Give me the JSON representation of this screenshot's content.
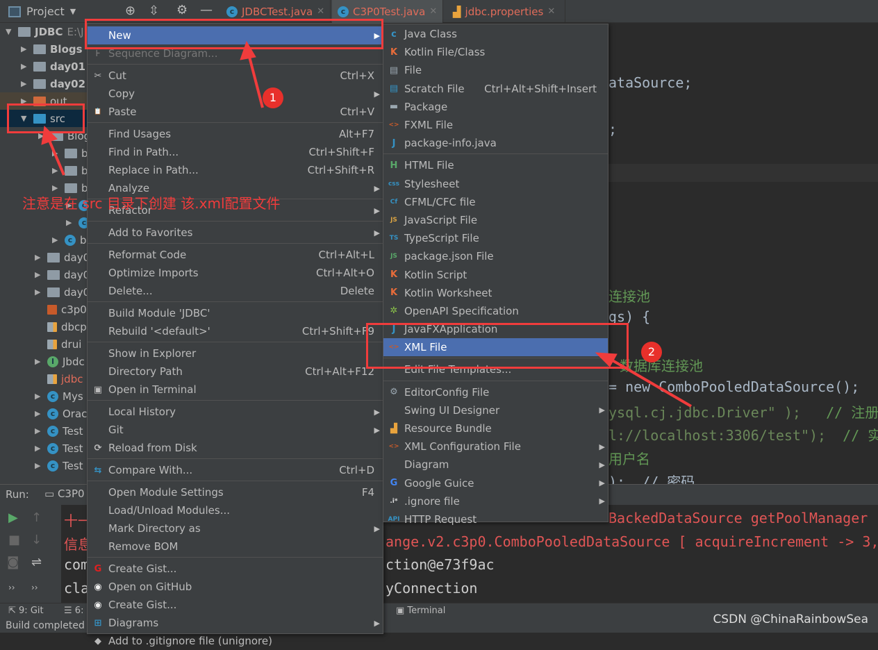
{
  "topbar": {
    "project_label": "Project",
    "tabs": [
      {
        "label": "JDBCTest.java",
        "active": false
      },
      {
        "label": "C3P0Test.java",
        "active": true
      },
      {
        "label": "jdbc.properties",
        "active": false
      }
    ]
  },
  "tree": [
    {
      "label": "JDBC",
      "suffix": "E:\\J",
      "icon": "module-folder",
      "expanded": true,
      "bold": true
    },
    {
      "label": "Blogs",
      "icon": "module-folder",
      "bold": true
    },
    {
      "label": "day01",
      "icon": "module-folder",
      "bold": true
    },
    {
      "label": "day02",
      "icon": "module-folder",
      "bold": true
    },
    {
      "label": "out",
      "icon": "excluded-folder"
    },
    {
      "label": "src",
      "icon": "source-folder",
      "expanded": true,
      "selected": true
    },
    {
      "label": "Blog",
      "icon": "package"
    },
    {
      "label": "b",
      "icon": "package"
    },
    {
      "label": "b",
      "icon": "package"
    },
    {
      "label": "b",
      "icon": "package"
    },
    {
      "label": "",
      "icon": "class"
    },
    {
      "label": "",
      "icon": "class"
    },
    {
      "label": "b",
      "icon": "class-run"
    },
    {
      "label": "day0",
      "icon": "package"
    },
    {
      "label": "day0",
      "icon": "package"
    },
    {
      "label": "day0",
      "icon": "package"
    },
    {
      "label": "c3p0",
      "icon": "xml-file"
    },
    {
      "label": "dbcp",
      "icon": "properties-file"
    },
    {
      "label": "drui",
      "icon": "properties-file"
    },
    {
      "label": "Jbdc",
      "icon": "interface"
    },
    {
      "label": "jdbc",
      "icon": "properties-file",
      "modified": true
    },
    {
      "label": "Mys",
      "icon": "class"
    },
    {
      "label": "Orac",
      "icon": "class"
    },
    {
      "label": "Test",
      "icon": "class-run"
    },
    {
      "label": "Test",
      "icon": "class-run"
    },
    {
      "label": "Test",
      "icon": "class"
    }
  ],
  "code": [
    {
      "text": "ataSource;",
      "tail": ""
    },
    {
      "text": ";",
      "tail": ""
    },
    {
      "text": "连接池",
      "tail": ""
    },
    {
      "text": "gs) {",
      "tail": ""
    },
    {
      "text": "数据库连接池",
      "tail": ""
    },
    {
      "text": "= new ComboPooledDataSource();",
      "tail": ""
    },
    {
      "text": "ysql.cj.jdbc.Driver\" );",
      "tail": "   // 注册"
    },
    {
      "text": "l://localhost:3306/test\");",
      "tail": "  // 实"
    },
    {
      "text": "用户名",
      "tail": ""
    },
    {
      "text": ");  // 密码",
      "tail": ""
    }
  ],
  "run": {
    "label": "Run:",
    "tab": "C3P0",
    "lines": [
      {
        "left": "十一",
        "right": "BackedDataSource getPoolManager"
      },
      {
        "left": "信息",
        "right": "ange.v2.c3p0.ComboPooledDataSource [ acquireIncrement -> 3,"
      },
      {
        "left": "com",
        "right": "ction@e73f9ac"
      },
      {
        "left": "cla",
        "right": "yConnection"
      }
    ]
  },
  "bottombar": {
    "git": "9: Git",
    "todo": "6:",
    "terminal": "Terminal"
  },
  "status": "Build completed",
  "main_menu": [
    {
      "label": "New",
      "submenu": true,
      "selected": true
    },
    {
      "label": "Sequence Diagram...",
      "disabled": true,
      "icon": "sequence"
    },
    {
      "sep": true
    },
    {
      "label": "Cut",
      "shortcut": "Ctrl+X",
      "icon": "scissors"
    },
    {
      "label": "Copy",
      "submenu": true
    },
    {
      "label": "Paste",
      "shortcut": "Ctrl+V",
      "icon": "clipboard"
    },
    {
      "sep": true
    },
    {
      "label": "Find Usages",
      "shortcut": "Alt+F7"
    },
    {
      "label": "Find in Path...",
      "shortcut": "Ctrl+Shift+F"
    },
    {
      "label": "Replace in Path...",
      "shortcut": "Ctrl+Shift+R"
    },
    {
      "label": "Analyze",
      "submenu": true
    },
    {
      "sep": true
    },
    {
      "label": "Refactor",
      "submenu": true
    },
    {
      "sep": true
    },
    {
      "label": "Add to Favorites",
      "submenu": true
    },
    {
      "sep": true
    },
    {
      "label": "Reformat Code",
      "shortcut": "Ctrl+Alt+L"
    },
    {
      "label": "Optimize Imports",
      "shortcut": "Ctrl+Alt+O"
    },
    {
      "label": "Delete...",
      "shortcut": "Delete"
    },
    {
      "sep": true
    },
    {
      "label": "Build Module 'JDBC'"
    },
    {
      "label": "Rebuild '<default>'",
      "shortcut": "Ctrl+Shift+F9"
    },
    {
      "sep": true
    },
    {
      "label": "Show in Explorer"
    },
    {
      "label": "Directory Path",
      "shortcut": "Ctrl+Alt+F12"
    },
    {
      "label": "Open in Terminal",
      "icon": "terminal"
    },
    {
      "sep": true
    },
    {
      "label": "Local History",
      "submenu": true
    },
    {
      "label": "Git",
      "submenu": true
    },
    {
      "label": "Reload from Disk",
      "icon": "reload"
    },
    {
      "sep": true
    },
    {
      "label": "Compare With...",
      "shortcut": "Ctrl+D",
      "icon": "compare"
    },
    {
      "sep": true
    },
    {
      "label": "Open Module Settings",
      "shortcut": "F4"
    },
    {
      "label": "Load/Unload Modules..."
    },
    {
      "label": "Mark Directory as",
      "submenu": true
    },
    {
      "label": "Remove BOM"
    },
    {
      "sep": true
    },
    {
      "label": "Create Gist...",
      "icon": "gitee"
    },
    {
      "label": "Open on GitHub",
      "icon": "github"
    },
    {
      "label": "Create Gist...",
      "icon": "github"
    },
    {
      "label": "Diagrams",
      "submenu": true,
      "icon": "diagram"
    },
    {
      "label": "Add to .gitignore file (unignore)",
      "icon": "gitignore"
    }
  ],
  "new_submenu": [
    {
      "label": "Java Class",
      "icon": "java-class"
    },
    {
      "label": "Kotlin File/Class",
      "icon": "kotlin"
    },
    {
      "label": "File",
      "icon": "file"
    },
    {
      "label": "Scratch File",
      "shortcut": "Ctrl+Alt+Shift+Insert",
      "icon": "scratch"
    },
    {
      "label": "Package",
      "icon": "package"
    },
    {
      "label": "FXML File",
      "icon": "xml"
    },
    {
      "label": "package-info.java",
      "icon": "java-file"
    },
    {
      "sep": true
    },
    {
      "label": "HTML File",
      "icon": "html"
    },
    {
      "label": "Stylesheet",
      "icon": "css"
    },
    {
      "label": "CFML/CFC file",
      "icon": "cfml"
    },
    {
      "label": "JavaScript File",
      "icon": "js"
    },
    {
      "label": "TypeScript File",
      "icon": "ts"
    },
    {
      "label": "package.json File",
      "icon": "nodejs"
    },
    {
      "label": "Kotlin Script",
      "icon": "kotlin"
    },
    {
      "label": "Kotlin Worksheet",
      "icon": "kotlin"
    },
    {
      "label": "OpenAPI Specification",
      "icon": "openapi"
    },
    {
      "label": "JavaFXApplication",
      "icon": "java-file"
    },
    {
      "label": "XML File",
      "icon": "xml",
      "selected": true
    },
    {
      "sep": true
    },
    {
      "label": "Edit File Templates..."
    },
    {
      "sep": true
    },
    {
      "label": "EditorConfig File",
      "icon": "gear"
    },
    {
      "label": "Swing UI Designer",
      "submenu": true
    },
    {
      "label": "Resource Bundle",
      "icon": "properties"
    },
    {
      "label": "XML Configuration File",
      "submenu": true,
      "icon": "xml"
    },
    {
      "label": "Diagram",
      "submenu": true
    },
    {
      "label": "Google Guice",
      "submenu": true,
      "icon": "google"
    },
    {
      "label": ".ignore file",
      "submenu": true,
      "icon": "ignore"
    },
    {
      "label": "HTTP Request",
      "icon": "api"
    }
  ],
  "annotations": {
    "step1": "1",
    "step2": "2",
    "note": "注意是在 src 目录下创建 该.xml配置文件",
    "watermark": "CSDN @ChinaRainbowSea"
  },
  "colors": {
    "highlight": "#4b6eaf",
    "annotation_red": "#f03c3c",
    "menu_bg": "#3c3f41",
    "editor_bg": "#2b2b2b"
  }
}
